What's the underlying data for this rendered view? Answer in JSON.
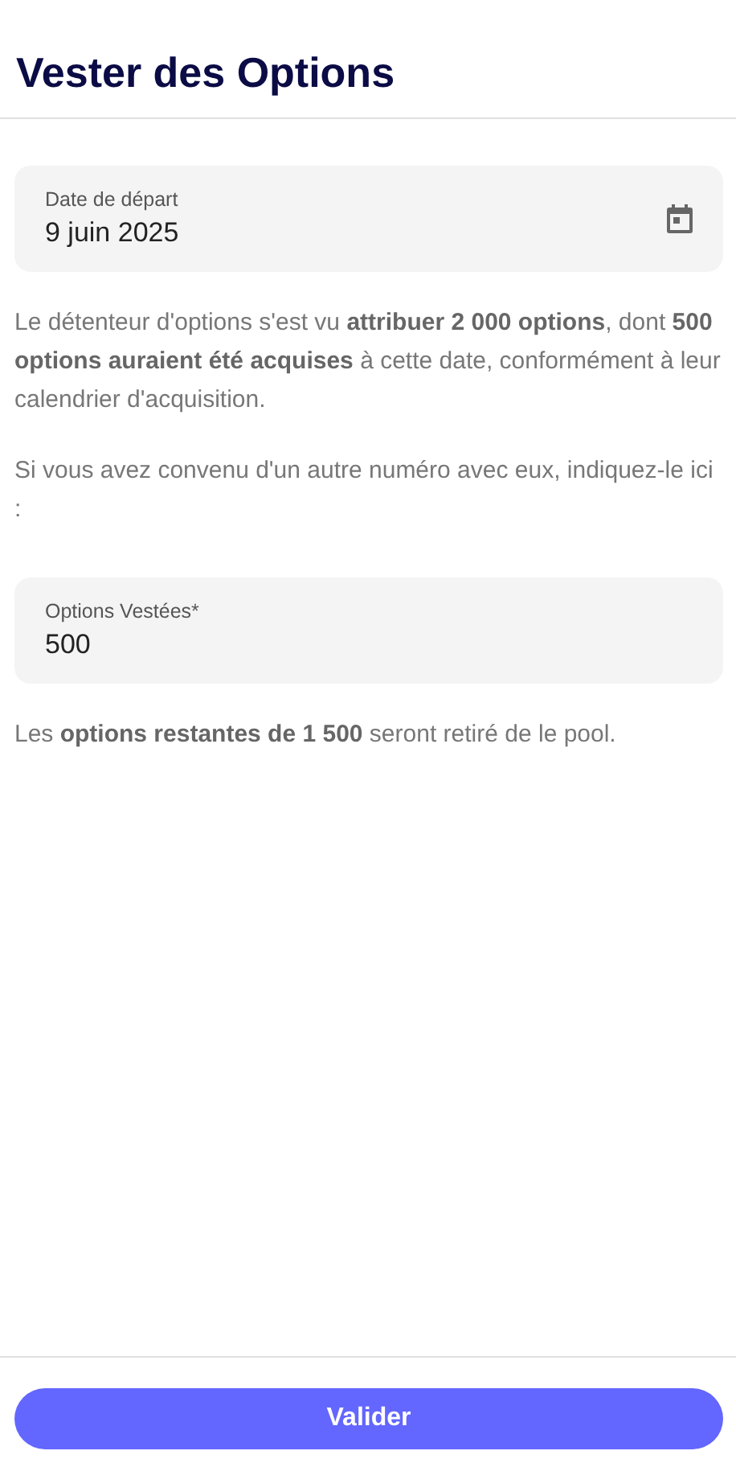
{
  "header": {
    "title": "Vester des Options"
  },
  "date_field": {
    "label": "Date de départ",
    "value": "9 juin 2025"
  },
  "paragraphs": [
    "Le détenteur d'options s'est vu **attribuer 2 000 options**, dont **500 options auraient été acquises** à cette date, conformément à leur calendrier d'acquisition.",
    "Si vous avez convenu d'un autre numéro avec eux, indiquez-le ici :"
  ],
  "options_field": {
    "label": "Options Vestées*",
    "value": "500"
  },
  "note": "Les **options restantes de 1 500** seront retiré de le pool.",
  "buttons": [
    "Valider"
  ]
}
